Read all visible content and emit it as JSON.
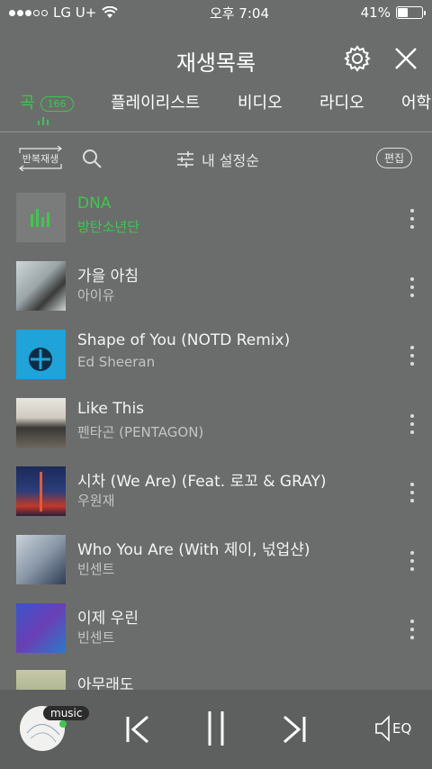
{
  "status": {
    "carrier": "LG U+",
    "time": "오후 7:04",
    "battery": "41%",
    "battery_level": 0.41
  },
  "header": {
    "title": "재생목록"
  },
  "tabs": [
    {
      "label": "곡",
      "count": "166",
      "active": true
    },
    {
      "label": "플레이리스트"
    },
    {
      "label": "비디오"
    },
    {
      "label": "라디오"
    },
    {
      "label": "어학"
    }
  ],
  "toolbar": {
    "repeat_label": "반복재생",
    "sort_label": "내 설정순",
    "edit_label": "편집"
  },
  "songs": [
    {
      "title": "DNA",
      "artist": "방탄소년단",
      "playing": true
    },
    {
      "title": "가을 아침",
      "artist": "아이유"
    },
    {
      "title": "Shape of You (NOTD Remix)",
      "artist": "Ed Sheeran"
    },
    {
      "title": "Like This",
      "artist": "펜타곤 (PENTAGON)"
    },
    {
      "title": "시차 (We Are) (Feat. 로꼬 & GRAY)",
      "artist": "우원재"
    },
    {
      "title": "Who You Are (With 제이, 넋업샨)",
      "artist": "빈센트"
    },
    {
      "title": "이제 우린",
      "artist": "빈센트"
    },
    {
      "title": "아무래도",
      "artist": ""
    }
  ],
  "player": {
    "badge": "music",
    "eq_label": "EQ"
  },
  "colors": {
    "accent": "#3fc650",
    "background": "#6b6d6c"
  }
}
